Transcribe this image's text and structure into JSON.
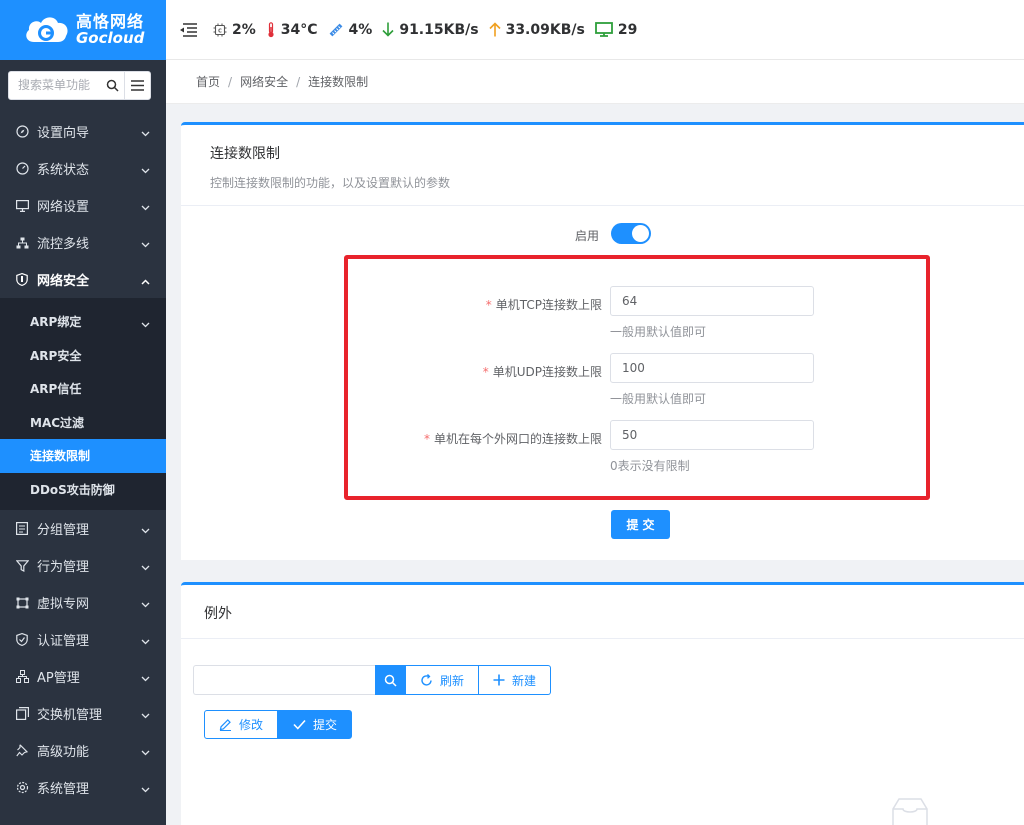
{
  "brand": {
    "name_cn": "高恪网络",
    "name_en": "Gocloud"
  },
  "sidebar": {
    "search_placeholder": "搜索菜单功能",
    "menu": [
      {
        "label": "设置向导",
        "icon": "compass-icon"
      },
      {
        "label": "系统状态",
        "icon": "dashboard-icon"
      },
      {
        "label": "网络设置",
        "icon": "monitor-icon"
      },
      {
        "label": "流控多线",
        "icon": "network-tree-icon"
      },
      {
        "label": "网络安全",
        "icon": "shield-icon"
      }
    ],
    "submenu": [
      {
        "label": "ARP绑定"
      },
      {
        "label": "ARP安全"
      },
      {
        "label": "ARP信任"
      },
      {
        "label": "MAC过滤"
      },
      {
        "label": "连接数限制"
      },
      {
        "label": "DDoS攻击防御"
      }
    ],
    "menu_after": [
      {
        "label": "分组管理",
        "icon": "group-icon"
      },
      {
        "label": "行为管理",
        "icon": "filter-icon"
      },
      {
        "label": "虚拟专网",
        "icon": "vpn-icon"
      },
      {
        "label": "认证管理",
        "icon": "shield-check-icon"
      },
      {
        "label": "AP管理",
        "icon": "ap-icon"
      },
      {
        "label": "交换机管理",
        "icon": "switch-icon"
      },
      {
        "label": "高级功能",
        "icon": "pin-icon"
      },
      {
        "label": "系统管理",
        "icon": "gear-icon"
      }
    ]
  },
  "topbar": {
    "cpu": "2%",
    "temperature": "34°C",
    "memory": "4%",
    "download": "91.15KB/s",
    "upload": "33.09KB/s",
    "terminals": "29",
    "colors": {
      "download": "#2e9e3a",
      "upload": "#f0a020",
      "temperature": "#e0303a",
      "terminals": "#2e9e3a"
    }
  },
  "breadcrumb": [
    "首页",
    "网络安全",
    "连接数限制"
  ],
  "form_card": {
    "title": "连接数限制",
    "desc": "控制连接数限制的功能，以及设置默认的参数",
    "enable_label": "启用",
    "enabled": true,
    "fields": [
      {
        "label": "单机TCP连接数上限",
        "value": "64",
        "hint": "一般用默认值即可"
      },
      {
        "label": "单机UDP连接数上限",
        "value": "100",
        "hint": "一般用默认值即可"
      },
      {
        "label": "单机在每个外网口的连接数上限",
        "value": "50",
        "hint": "0表示没有限制"
      }
    ],
    "submit_label": "提交"
  },
  "exception_card": {
    "title": "例外",
    "refresh_label": "刷新",
    "new_label": "新建",
    "edit_label": "修改",
    "submit_label": "提交"
  },
  "accent_color": "#1e90ff"
}
